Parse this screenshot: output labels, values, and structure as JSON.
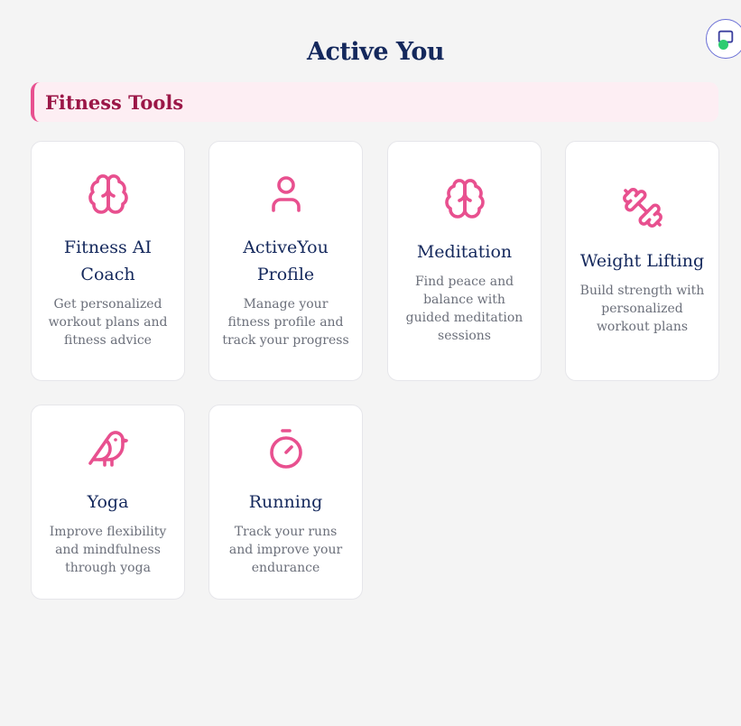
{
  "app": {
    "title": "Active You"
  },
  "section": {
    "title": "Fitness Tools"
  },
  "tools": [
    {
      "title": "Fitness AI Coach",
      "description": "Get personalized workout plans and fitness advice",
      "icon": "brain-icon"
    },
    {
      "title": "ActiveYou Profile",
      "description": "Manage your fitness profile and track your progress",
      "icon": "user-icon"
    },
    {
      "title": "Meditation",
      "description": "Find peace and balance with guided meditation sessions",
      "icon": "brain-icon"
    },
    {
      "title": "Weight Lifting",
      "description": "Build strength with personalized workout plans",
      "icon": "dumbbell-icon"
    },
    {
      "title": "Yoga",
      "description": "Improve flexibility and mindfulness through yoga",
      "icon": "bird-icon"
    },
    {
      "title": "Running",
      "description": "Track your runs and improve your endurance",
      "icon": "stopwatch-icon"
    }
  ],
  "chat_widget": {
    "icon": "chat-icon",
    "status_color": "#2ecc71"
  },
  "colors": {
    "accent": "#e8508f",
    "heading": "#14285c",
    "section_text": "#9b1747",
    "section_bg": "#fdeef3"
  }
}
